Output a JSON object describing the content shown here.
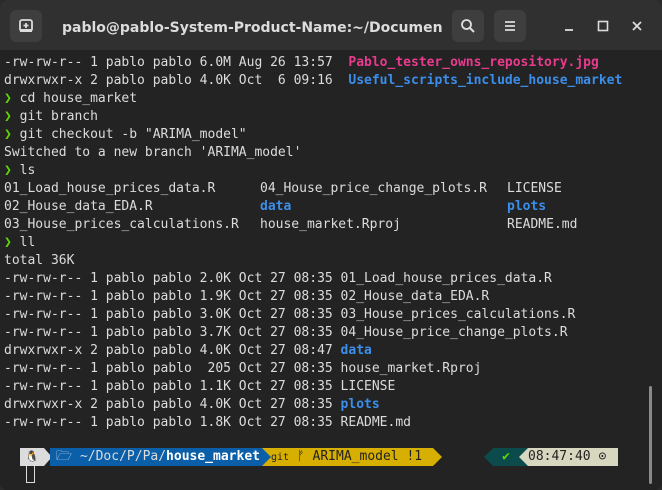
{
  "window": {
    "title": "pablo@pablo-System-Product-Name:~/Documents/Pa...",
    "icons": [
      "new-tab-icon",
      "search-icon",
      "menu-icon",
      "minimize-icon",
      "maximize-icon",
      "close-icon"
    ]
  },
  "output": {
    "l1": {
      "prefix": "-rw-rw-r-- 1 pablo pablo 6.0M Aug 26 13:57  ",
      "name": "Pablo_tester_owns_repository.jpg"
    },
    "l2": {
      "prefix": "drwxrwxr-x 2 pablo pablo 4.0K Oct  6 09:16  ",
      "name": "Useful_scripts_include_house_market"
    },
    "cmd1": "cd house_market",
    "cmd2": "git branch",
    "cmd3": "git checkout -b \"ARIMA_model\"",
    "switched": "Switched to a new branch 'ARIMA_model'",
    "cmd4": "ls",
    "ls_rows": [
      [
        "01_Load_house_prices_data.R",
        "04_House_price_change_plots.R",
        "LICENSE"
      ],
      [
        "02_House_data_EDA.R",
        "data",
        "plots"
      ],
      [
        "03_House_prices_calculations.R",
        "house_market.Rproj",
        "README.md"
      ]
    ],
    "cmd5": "ll",
    "total": "total 36K",
    "ll_rows": [
      {
        "prefix": "-rw-rw-r-- 1 pablo pablo 2.0K Oct 27 08:35 ",
        "name": "01_Load_house_prices_data.R"
      },
      {
        "prefix": "-rw-rw-r-- 1 pablo pablo 1.9K Oct 27 08:35 ",
        "name": "02_House_data_EDA.R"
      },
      {
        "prefix": "-rw-rw-r-- 1 pablo pablo 3.0K Oct 27 08:35 ",
        "name": "03_House_prices_calculations.R"
      },
      {
        "prefix": "-rw-rw-r-- 1 pablo pablo 3.7K Oct 27 08:35 ",
        "name": "04_House_price_change_plots.R"
      },
      {
        "prefix": "drwxrwxr-x 2 pablo pablo 4.0K Oct 27 08:47 ",
        "name": "data"
      },
      {
        "prefix": "-rw-rw-r-- 1 pablo pablo  205 Oct 27 08:35 ",
        "name": "house_market.Rproj"
      },
      {
        "prefix": "-rw-rw-r-- 1 pablo pablo 1.1K Oct 27 08:35 ",
        "name": "LICENSE"
      },
      {
        "prefix": "drwxrwxr-x 2 pablo pablo 4.0K Oct 27 08:35 ",
        "name": "plots"
      },
      {
        "prefix": "-rw-rw-r-- 1 pablo pablo 1.8K Oct 27 08:35 ",
        "name": "README.md"
      }
    ],
    "prompt_symbol": "❯"
  },
  "powerline": {
    "os_icon": "🐧",
    "folder_icon": "🗁",
    "path_prefix": "~/Doc/P/Pa/",
    "path_current": "house_market",
    "git_label": "git",
    "branch_icon": "ᚠ",
    "branch": "ARIMA_model !1",
    "check": "✔",
    "time": "08:47:40",
    "clock_icon": "⊙"
  },
  "colors": {
    "prompt": "#5fd700",
    "dir": "#3b8eea",
    "image": "#e83b8e",
    "path_bg": "#0a5fa8",
    "git_bg": "#d7af00",
    "time_bg": "#d7d7c0",
    "status_bg": "#0b4b4b"
  }
}
